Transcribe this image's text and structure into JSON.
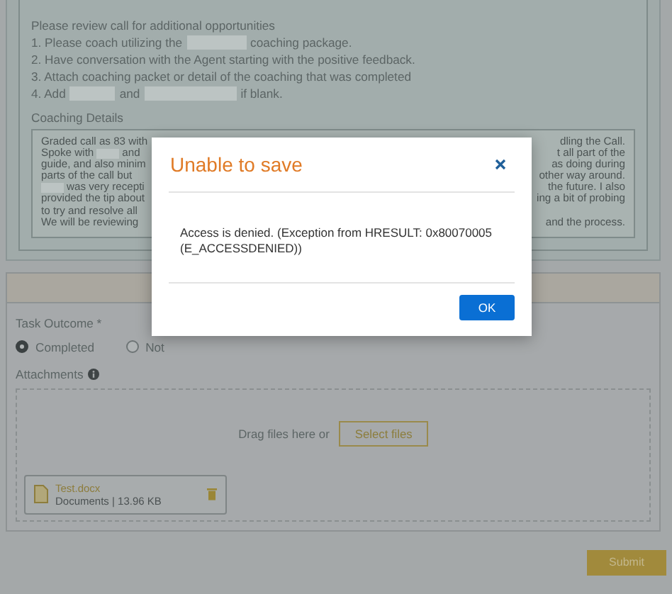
{
  "instructions": {
    "heading": "Please review call for additional opportunities",
    "lines": [
      {
        "parts": [
          "1. Please coach utilizing the",
          "coaching package."
        ]
      },
      {
        "parts": [
          "2. Have conversation with the Agent starting with the positive feedback."
        ]
      },
      {
        "parts": [
          "3. Attach coaching packet or detail of the coaching that was completed"
        ]
      },
      {
        "parts": [
          "4. Add",
          "and",
          "if blank."
        ]
      }
    ]
  },
  "coaching_details": {
    "label": "Coaching Details",
    "lines": [
      {
        "left": [
          {
            "kind": "text",
            "text": "Graded call as 83 with"
          }
        ],
        "right": "dling the Call."
      },
      {
        "left": [
          {
            "kind": "text",
            "text": "Spoke with"
          },
          {
            "kind": "redacted"
          },
          {
            "kind": "text",
            "text": "and"
          }
        ],
        "right": "t all part of the"
      },
      {
        "left": [
          {
            "kind": "text",
            "text": "guide, and also minim"
          }
        ],
        "right": "as doing during"
      },
      {
        "left": [
          {
            "kind": "text",
            "text": "parts of the call but"
          }
        ],
        "right": "other way around."
      },
      {
        "left": [
          {
            "kind": "redacted"
          },
          {
            "kind": "text",
            "text": "was very recepti"
          }
        ],
        "right": "the future. I also"
      },
      {
        "left": [
          {
            "kind": "text",
            "text": "provided the tip about"
          }
        ],
        "right": "ing a bit of probing"
      },
      {
        "left": [
          {
            "kind": "text",
            "text": "to try and resolve all"
          }
        ]
      },
      {
        "left": [
          {
            "kind": "text",
            "text": "We will be reviewing"
          }
        ],
        "right": "and the process."
      }
    ]
  },
  "task_outcome": {
    "label": "Task Outcome *",
    "options": [
      {
        "label": "Completed",
        "selected": true
      },
      {
        "label": "Not",
        "selected": false
      }
    ]
  },
  "attachments": {
    "label": "Attachments",
    "drop_text": "Drag files here or",
    "select_button": "Select files",
    "files": [
      {
        "name": "Test.docx",
        "meta": "Documents | 13.96 KB"
      }
    ]
  },
  "submit": "Submit",
  "dialog": {
    "title": "Unable to save",
    "message": "Access is denied. (Exception from HRESULT: 0x80070005 (E_ACCESSDENIED))",
    "ok": "OK"
  }
}
